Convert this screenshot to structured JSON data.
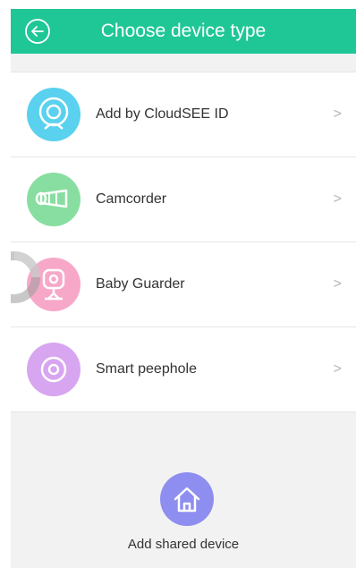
{
  "header": {
    "title": "Choose device type",
    "back_icon": "back-arrow-icon",
    "color": "#1fc797"
  },
  "device_types": [
    {
      "label": "Add by CloudSEE ID",
      "icon": "webcam-icon",
      "color": "#5ad1ee",
      "chevron": ">"
    },
    {
      "label": "Camcorder",
      "icon": "bullet-camera-icon",
      "color": "#88dea0",
      "chevron": ">"
    },
    {
      "label": "Baby Guarder",
      "icon": "baby-camera-icon",
      "color": "#f7a8c8",
      "chevron": ">"
    },
    {
      "label": "Smart peephole",
      "icon": "peephole-icon",
      "color": "#d8a5f0",
      "chevron": ">"
    }
  ],
  "shared_device": {
    "label": "Add shared device",
    "icon": "home-icon",
    "color": "#8e8ef0"
  }
}
